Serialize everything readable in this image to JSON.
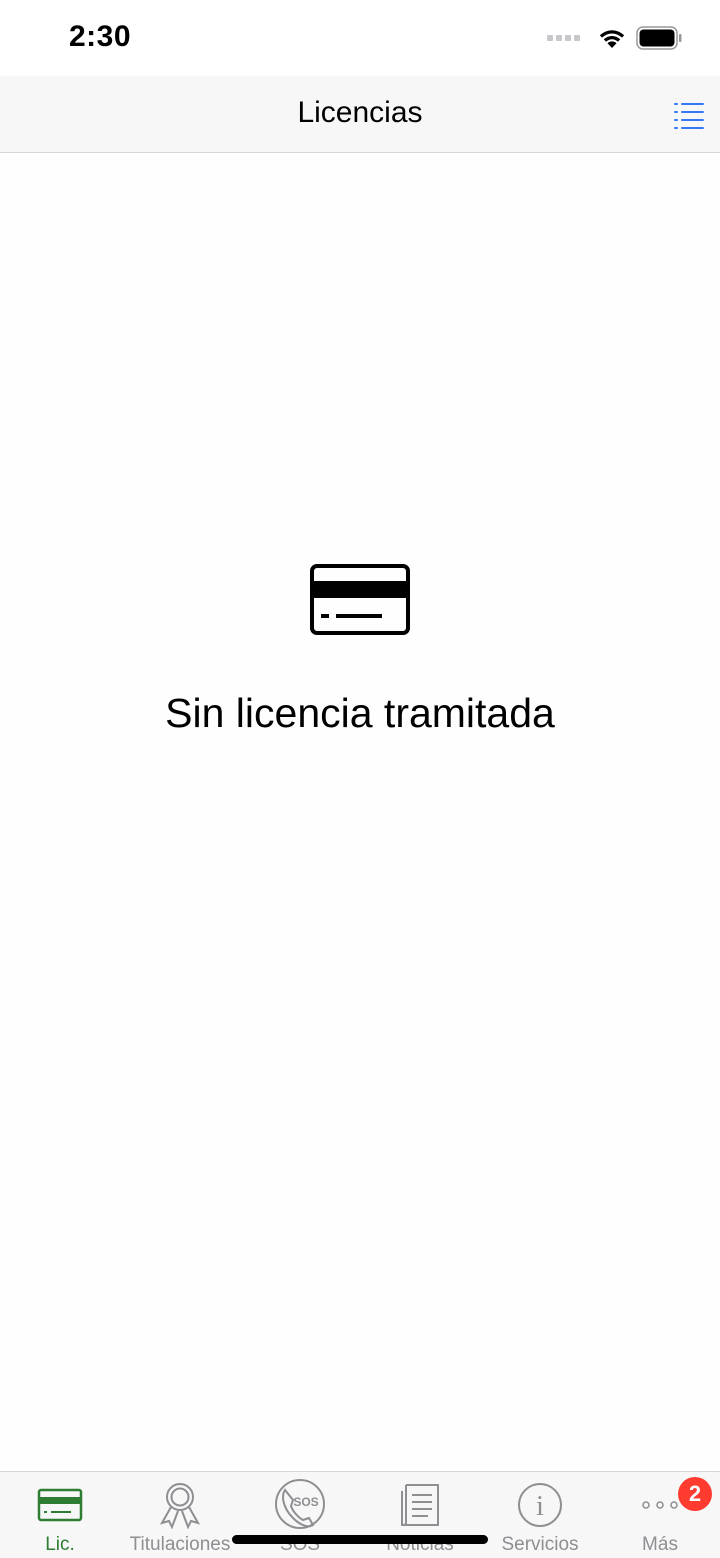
{
  "status_bar": {
    "time": "2:30"
  },
  "nav": {
    "title": "Licencias",
    "menu_icon": "list-icon"
  },
  "empty_state": {
    "icon": "credit-card-icon",
    "message": "Sin licencia tramitada"
  },
  "tabs": [
    {
      "label": "Lic.",
      "icon": "credit-card-icon",
      "active": true
    },
    {
      "label": "Titulaciones",
      "icon": "award-ribbon-icon",
      "active": false
    },
    {
      "label": "SOS",
      "icon": "sos-phone-icon",
      "active": false
    },
    {
      "label": "Noticias",
      "icon": "newspaper-icon",
      "active": false
    },
    {
      "label": "Servicios",
      "icon": "info-icon",
      "active": false
    },
    {
      "label": "Más",
      "icon": "more-dots-icon",
      "active": false,
      "badge": "2"
    }
  ],
  "colors": {
    "accent": "#2e7d32",
    "link": "#3478f6",
    "badge": "#ff3b30",
    "inactive": "#8e8e93"
  }
}
